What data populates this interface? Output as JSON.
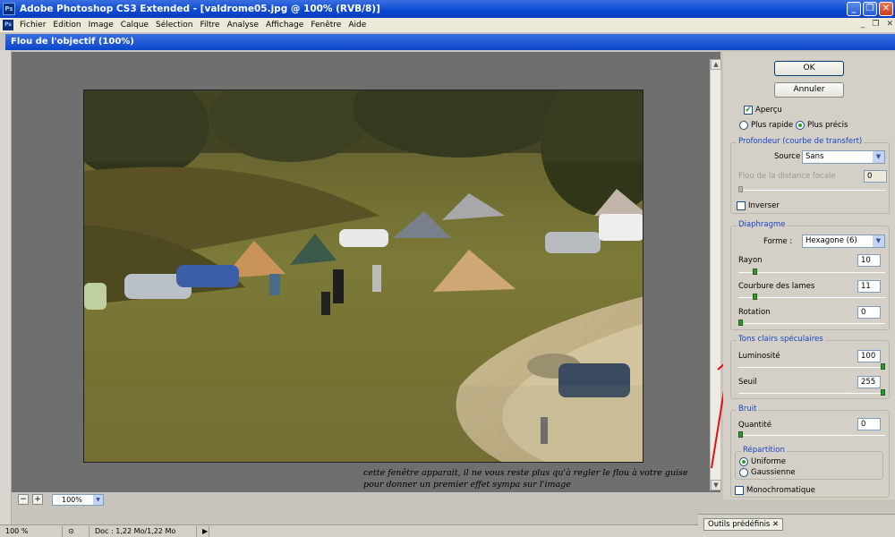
{
  "window": {
    "title": "Adobe Photoshop CS3 Extended - [valdrome05.jpg @ 100% (RVB/8)]",
    "app_icon": "Ps"
  },
  "menu": [
    "Fichier",
    "Edition",
    "Image",
    "Calque",
    "Sélection",
    "Filtre",
    "Analyse",
    "Affichage",
    "Fenêtre",
    "Aide"
  ],
  "dialog": {
    "title": "Flou de l'objectif (100%)",
    "ok_label": "OK",
    "cancel_label": "Annuler",
    "preview": {
      "apercu_label": "Aperçu",
      "apercu_checked": true,
      "fast_label": "Plus rapide",
      "precise_label": "Plus précis",
      "selected": "precise"
    },
    "depth": {
      "title": "Profondeur (courbe de transfert)",
      "source_label": "Source :",
      "source_value": "Sans",
      "focal_label": "Flou de la distance focale",
      "focal_value": "0",
      "invert_label": "Inverser"
    },
    "iris": {
      "title": "Diaphragme",
      "shape_label": "Forme :",
      "shape_value": "Hexagone (6)",
      "radius_label": "Rayon",
      "radius_value": "10",
      "curvature_label": "Courbure des lames",
      "curvature_value": "11",
      "rotation_label": "Rotation",
      "rotation_value": "0"
    },
    "specular": {
      "title": "Tons clairs spéculaires",
      "brightness_label": "Luminosité",
      "brightness_value": "100",
      "threshold_label": "Seuil",
      "threshold_value": "255"
    },
    "noise": {
      "title": "Bruit",
      "amount_label": "Quantité",
      "amount_value": "0",
      "distribution_title": "Répartition",
      "uniform_label": "Uniforme",
      "gaussian_label": "Gaussienne",
      "selected": "uniform",
      "mono_label": "Monochromatique"
    },
    "zoom_value": "100%"
  },
  "annotation": {
    "line1": "cette fenêtre apparait, il ne vous reste plus qu'à regler le flou à votre guise",
    "line2": "pour donner un premier effet sympa sur l'image"
  },
  "status": {
    "zoom": "100 %",
    "doc": "Doc : 1,22 Mo/1,22 Mo"
  },
  "tools_panel_tab": "Outils prédéfinis"
}
